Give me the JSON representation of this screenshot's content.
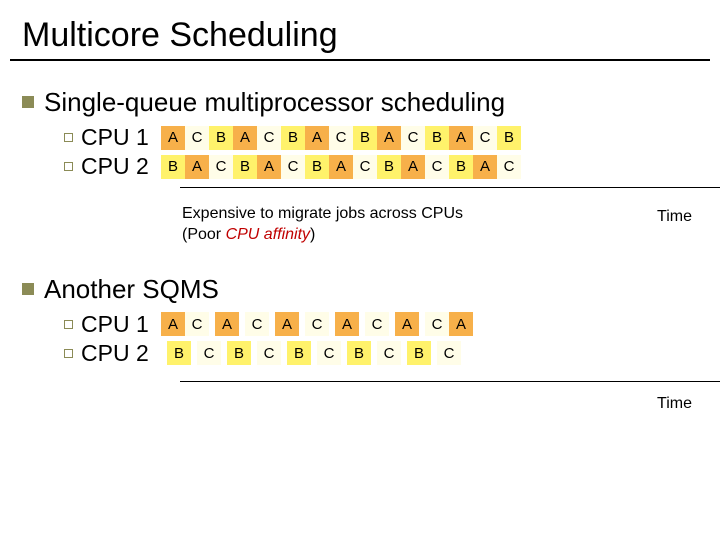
{
  "title": "Multicore Scheduling",
  "section1": {
    "heading": "Single-queue multiprocessor scheduling",
    "rows": [
      {
        "label": "CPU 1",
        "cells": [
          "A",
          "C",
          "B",
          "A",
          "C",
          "B",
          "A",
          "C",
          "B",
          "A",
          "C",
          "B",
          "A",
          "C",
          "B"
        ]
      },
      {
        "label": "CPU 2",
        "cells": [
          "B",
          "A",
          "C",
          "B",
          "A",
          "C",
          "B",
          "A",
          "C",
          "B",
          "A",
          "C",
          "B",
          "A",
          "C"
        ]
      }
    ],
    "caption_line1": "Expensive to migrate jobs across CPUs",
    "caption_line2_pre": "(Poor ",
    "caption_line2_em": "CPU affinity",
    "caption_line2_post": ")",
    "time_label": "Time"
  },
  "section2": {
    "heading": "Another SQMS",
    "rows": [
      {
        "label": "CPU 1",
        "cells": [
          "A",
          "C",
          "",
          "A",
          "",
          "C",
          "",
          "A",
          "",
          "C",
          "",
          "A",
          "",
          "C",
          "",
          "A",
          "",
          "C",
          "A"
        ]
      },
      {
        "label": "CPU 2",
        "cells": [
          "",
          "B",
          "",
          "C",
          "",
          "B",
          "",
          "C",
          "",
          "B",
          "",
          "C",
          "",
          "B",
          "",
          "C",
          "",
          "B",
          "",
          "C"
        ]
      }
    ],
    "time_label": "Time"
  }
}
